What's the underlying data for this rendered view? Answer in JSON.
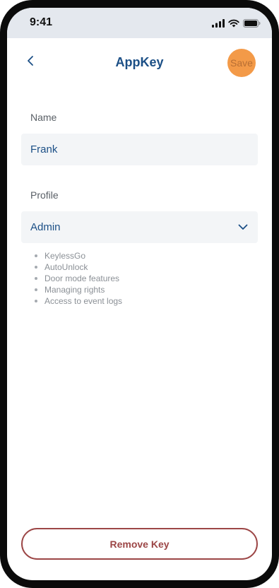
{
  "status_bar": {
    "time": "9:41",
    "icons": [
      "cellular-signal-icon",
      "wifi-icon",
      "battery-icon"
    ]
  },
  "header": {
    "title": "AppKey",
    "back_icon": "chevron-left-icon",
    "save_label": "Save"
  },
  "form": {
    "name": {
      "label": "Name",
      "value": "Frank"
    },
    "profile": {
      "label": "Profile",
      "selected": "Admin",
      "chevron_icon": "chevron-down-icon"
    },
    "features": [
      "KeylessGo",
      "AutoUnlock",
      "Door mode features",
      "Managing rights",
      "Access to event logs"
    ]
  },
  "footer": {
    "remove_label": "Remove Key"
  },
  "colors": {
    "primary_text": "#1b4f86",
    "save_accent": "#f39a48",
    "danger": "#9c4646",
    "field_background": "#f3f5f7",
    "status_bar_background": "#e4e8ee"
  }
}
